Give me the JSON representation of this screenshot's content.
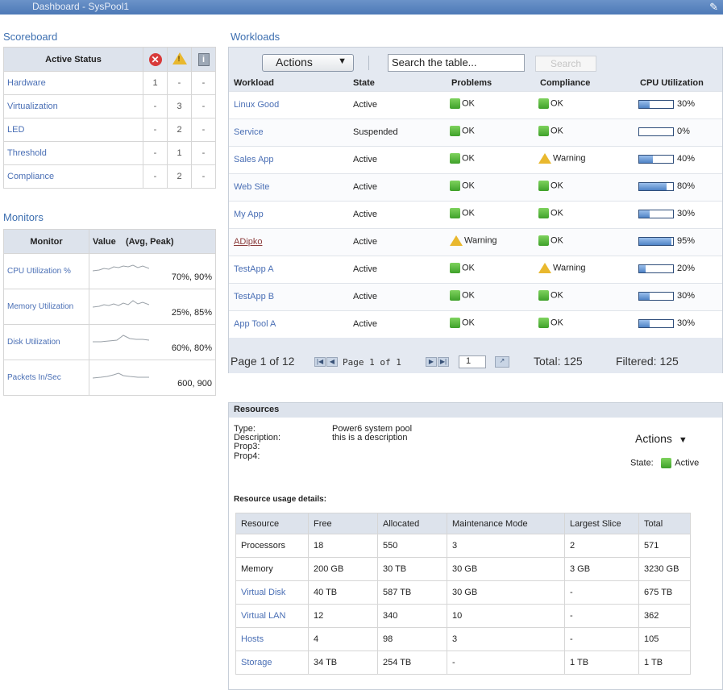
{
  "topbar": {
    "title": "Dashboard - SysPool1"
  },
  "scoreboard": {
    "title": "Scoreboard",
    "header": "Active Status",
    "rows": [
      {
        "label": "Hardware",
        "err": "1",
        "warn": "-",
        "info": "-"
      },
      {
        "label": "Virtualization",
        "err": "-",
        "warn": "3",
        "info": "-"
      },
      {
        "label": "LED",
        "err": "-",
        "warn": "2",
        "info": "-"
      },
      {
        "label": "Threshold",
        "err": "-",
        "warn": "1",
        "info": "-"
      },
      {
        "label": "Compliance",
        "err": "-",
        "warn": "2",
        "info": "-"
      }
    ]
  },
  "monitors": {
    "title": "Monitors",
    "col_monitor": "Monitor",
    "col_value": "Value",
    "col_avgpeak": "(Avg, Peak)",
    "rows": [
      {
        "label": "CPU Utilization %",
        "value": "70%, 90%"
      },
      {
        "label": "Memory Utilization",
        "value": "25%, 85%"
      },
      {
        "label": "Disk Utilization",
        "value": "60%, 80%"
      },
      {
        "label": "Packets In/Sec",
        "value": "600, 900"
      }
    ]
  },
  "workloads": {
    "title": "Workloads",
    "actions_label": "Actions",
    "search_placeholder": "Search the table...",
    "search_button": "Search",
    "columns": [
      "Workload",
      "State",
      "Problems",
      "Compliance",
      "CPU Utilization"
    ],
    "rows": [
      {
        "name": "Linux Good",
        "state": "Active",
        "problems": "OK",
        "problems_warn": false,
        "compliance": "OK",
        "compliance_warn": false,
        "cpu": "30%",
        "cpu_frac": 0.3
      },
      {
        "name": "Service",
        "state": "Suspended",
        "problems": "OK",
        "problems_warn": false,
        "compliance": "OK",
        "compliance_warn": false,
        "cpu": "0%",
        "cpu_frac": 0.0
      },
      {
        "name": "Sales App",
        "state": "Active",
        "problems": "OK",
        "problems_warn": false,
        "compliance": "Warning",
        "compliance_warn": true,
        "cpu": "40%",
        "cpu_frac": 0.4
      },
      {
        "name": "Web Site",
        "state": "Active",
        "problems": "OK",
        "problems_warn": false,
        "compliance": "OK",
        "compliance_warn": false,
        "cpu": "80%",
        "cpu_frac": 0.8
      },
      {
        "name": "My App",
        "state": "Active",
        "problems": "OK",
        "problems_warn": false,
        "compliance": "OK",
        "compliance_warn": false,
        "cpu": "30%",
        "cpu_frac": 0.3
      },
      {
        "name": "ADipko",
        "state": "Active",
        "problems": "Warning",
        "problems_warn": true,
        "compliance": "OK",
        "compliance_warn": false,
        "cpu": "95%",
        "cpu_frac": 0.95
      },
      {
        "name": "TestApp A",
        "state": "Active",
        "problems": "OK",
        "problems_warn": false,
        "compliance": "Warning",
        "compliance_warn": true,
        "cpu": "20%",
        "cpu_frac": 0.2
      },
      {
        "name": "TestApp B",
        "state": "Active",
        "problems": "OK",
        "problems_warn": false,
        "compliance": "OK",
        "compliance_warn": false,
        "cpu": "30%",
        "cpu_frac": 0.3
      },
      {
        "name": "App Tool A",
        "state": "Active",
        "problems": "OK",
        "problems_warn": false,
        "compliance": "OK",
        "compliance_warn": false,
        "cpu": "30%",
        "cpu_frac": 0.3
      }
    ],
    "pager": {
      "page_text": "Page 1 of 12",
      "inner_page_text": "Page 1 of 1",
      "page_input": "1",
      "total": "Total: 125",
      "filtered": "Filtered: 125"
    }
  },
  "resources": {
    "title": "Resources",
    "type_label": "Type:",
    "type_value": "Power6 system pool",
    "desc_label": "Description:",
    "desc_value": "this is a description",
    "prop3_label": "Prop3:",
    "prop4_label": "Prop4:",
    "actions_label": "Actions",
    "state_label": "State:",
    "state_value": "Active",
    "usage_title": "Resource usage details:",
    "columns": [
      "Resource",
      "Free",
      "Allocated",
      "Maintenance Mode",
      "Largest Slice",
      "Total"
    ],
    "rows": [
      {
        "resource": "Processors",
        "link": false,
        "free": "18",
        "allocated": "550",
        "maint": "3",
        "largest": "2",
        "total": "571"
      },
      {
        "resource": "Memory",
        "link": false,
        "free": "200 GB",
        "allocated": "30 TB",
        "maint": "30 GB",
        "largest": "3 GB",
        "total": "3230 GB"
      },
      {
        "resource": "Virtual Disk",
        "link": true,
        "free": "40 TB",
        "allocated": "587 TB",
        "maint": "30 GB",
        "largest": "-",
        "total": "675 TB"
      },
      {
        "resource": "Virtual LAN",
        "link": true,
        "free": "12",
        "allocated": "340",
        "maint": "10",
        "largest": "-",
        "total": "362"
      },
      {
        "resource": "Hosts",
        "link": true,
        "free": "4",
        "allocated": "98",
        "maint": "3",
        "largest": "-",
        "total": "105"
      },
      {
        "resource": "Storage",
        "link": true,
        "free": "34 TB",
        "allocated": "254 TB",
        "maint": "-",
        "largest": "1 TB",
        "total": "1 TB"
      }
    ]
  }
}
